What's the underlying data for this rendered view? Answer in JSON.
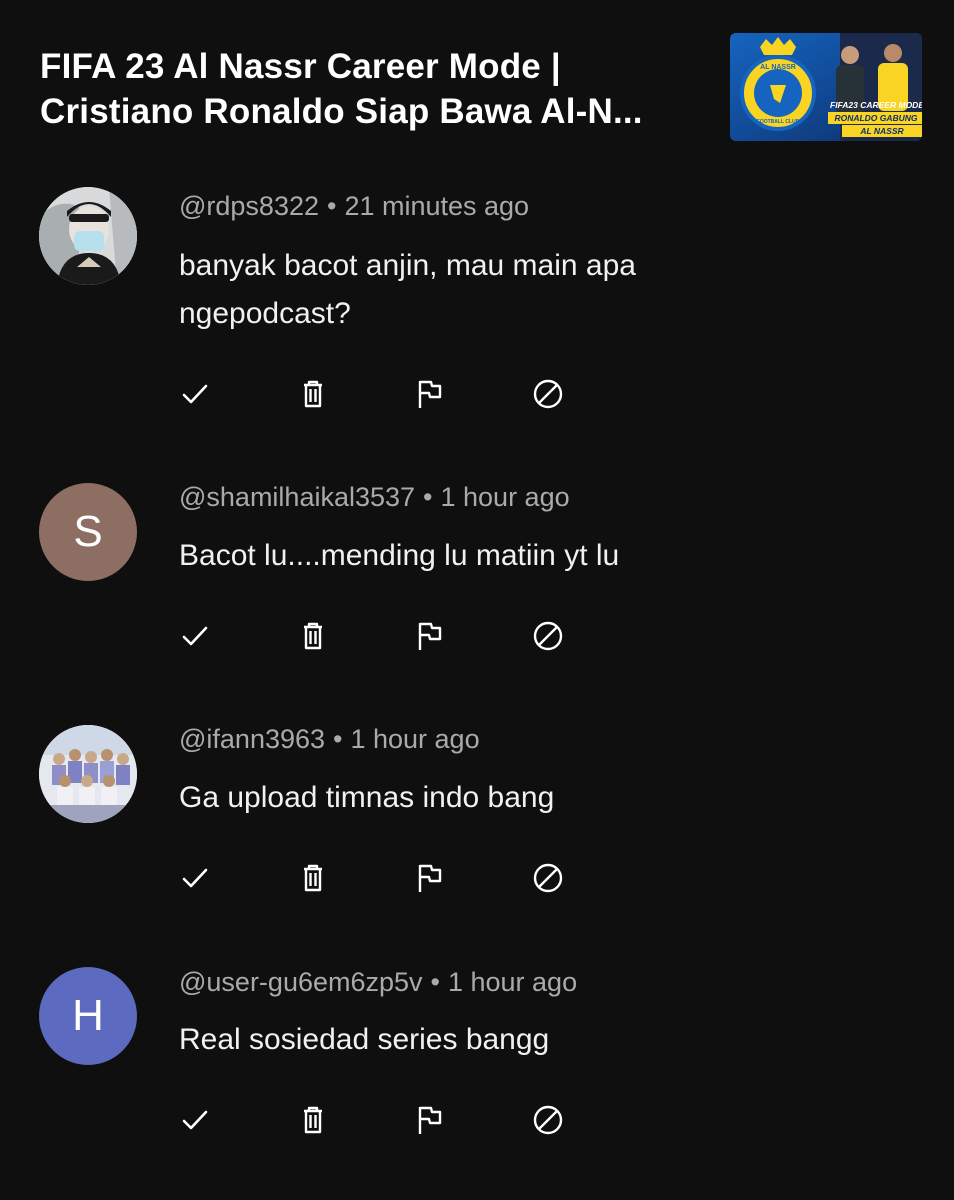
{
  "video": {
    "title_line1": "FIFA 23 Al Nassr Career Mode |",
    "title_line2": "Cristiano Ronaldo Siap Bawa Al-N...",
    "thumbnail_text": {
      "badge": "FIFA23 CAREER MODE",
      "headline": "RONALDO GABUNG",
      "sub": "AL NASSR",
      "logo_text": "AL NASSR",
      "logo_sub": "FOOTBALL CLUB"
    }
  },
  "comments": [
    {
      "handle": "@rdps8322",
      "time": "21 minutes ago",
      "text_lines": [
        "banyak bacot anjin, mau main apa",
        "ngepodcast?"
      ],
      "avatar_type": "photo",
      "avatar_letter": ""
    },
    {
      "handle": "@shamilhaikal3537",
      "time": "1 hour ago",
      "text_lines": [
        "Bacot lu....mending lu matiin yt lu"
      ],
      "avatar_type": "letter",
      "avatar_letter": "S",
      "avatar_color": "#8d6e63"
    },
    {
      "handle": "@ifann3963",
      "time": "1 hour ago",
      "text_lines": [
        "Ga upload timnas indo bang"
      ],
      "avatar_type": "photo",
      "avatar_letter": ""
    },
    {
      "handle": "@user-gu6em6zp5v",
      "time": "1 hour ago",
      "text_lines": [
        "Real sosiedad series bangg"
      ],
      "avatar_type": "letter",
      "avatar_letter": "H",
      "avatar_color": "#5c6bc0"
    }
  ],
  "separator": "•",
  "actions": [
    "checkmark-icon",
    "trash-icon",
    "flag-icon",
    "block-icon"
  ]
}
